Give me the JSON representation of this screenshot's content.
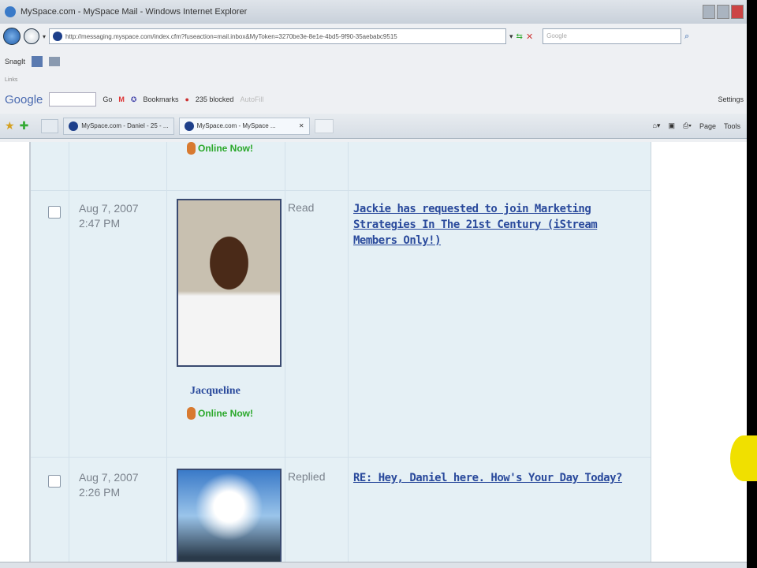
{
  "window": {
    "title": "MySpace.com - MySpace Mail - Windows Internet Explorer"
  },
  "address": {
    "url": "http://messaging.myspace.com/index.cfm?fuseaction=mail.inbox&MyToken=3270be3e-8e1e-4bd5-9f90-35aebabc9515",
    "search_placeholder": "Google"
  },
  "toolbar": {
    "snagit": "SnagIt",
    "links": "Links",
    "google": "Google",
    "go": "Go",
    "bookmarks": "Bookmarks",
    "blocked": "235 blocked",
    "autofill": "AutoFill",
    "settings": "Settings"
  },
  "tabs": [
    {
      "label": "MySpace.com - Daniel - 25 - ..."
    },
    {
      "label": "MySpace.com - MySpace ..."
    }
  ],
  "command_bar": {
    "page": "Page",
    "tools": "Tools"
  },
  "messages": [
    {
      "online": "Online Now!"
    },
    {
      "date": "Aug 7, 2007",
      "time": "2:47 PM",
      "status": "Read",
      "subject": "Jackie has requested to join Marketing Strategies In The 21st Century (iStream Members Only!)",
      "sender": "Jacqueline",
      "online": "Online Now!"
    },
    {
      "date": "Aug 7, 2007",
      "time": "2:26 PM",
      "status": "Replied",
      "subject": "RE: Hey, Daniel here. How's Your Day Today?"
    }
  ]
}
